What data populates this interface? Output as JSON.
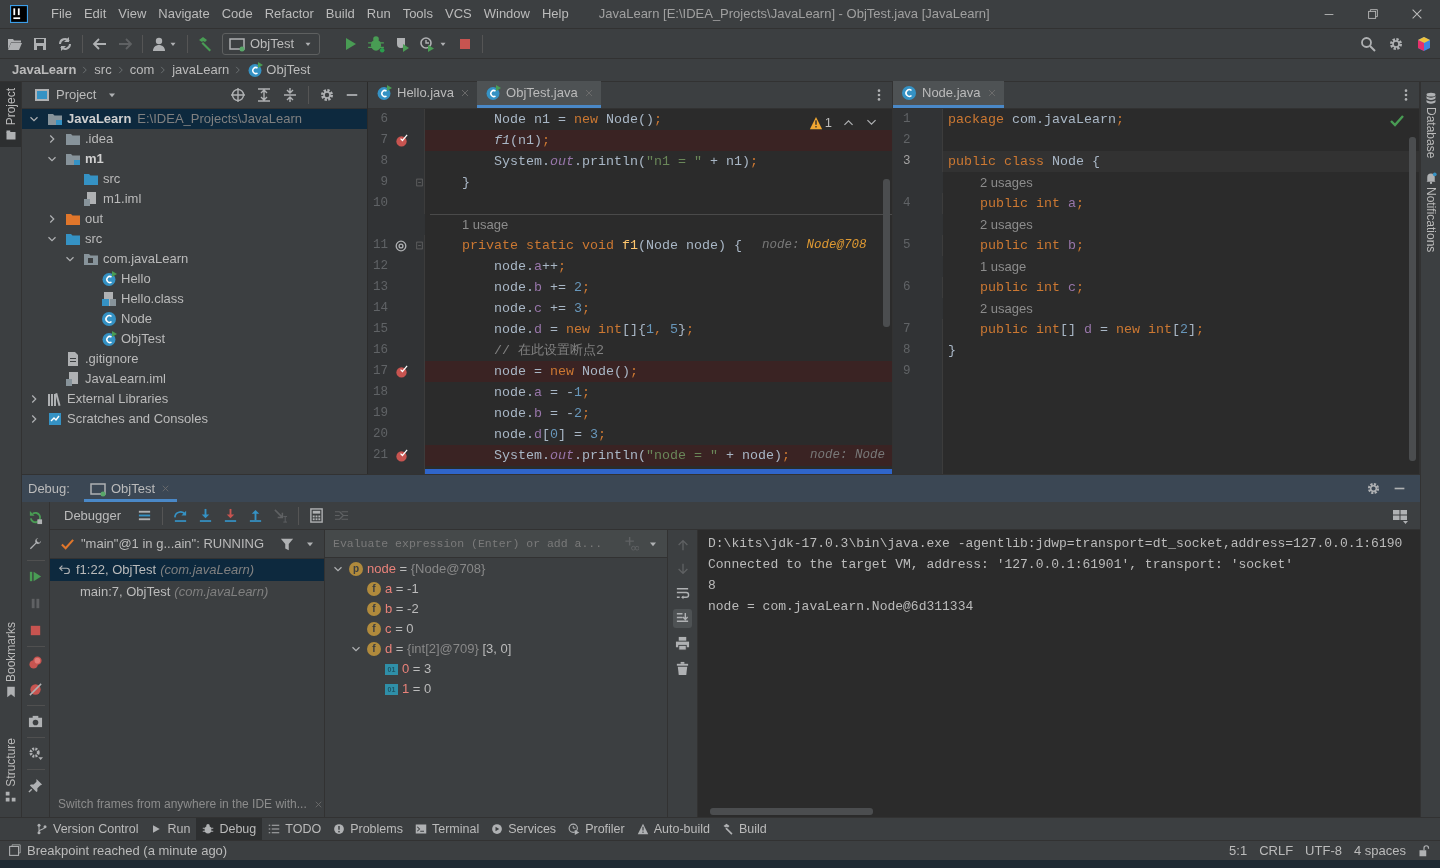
{
  "window": {
    "title": "JavaLearn [E:\\IDEA_Projects\\JavaLearn] - ObjTest.java [JavaLearn]"
  },
  "menu": [
    "File",
    "Edit",
    "View",
    "Navigate",
    "Code",
    "Refactor",
    "Build",
    "Run",
    "Tools",
    "VCS",
    "Window",
    "Help"
  ],
  "toolbar": {
    "run_config": "ObjTest"
  },
  "breadcrumb": [
    {
      "label": "JavaLearn",
      "kind": "project"
    },
    {
      "label": "src",
      "kind": "dir"
    },
    {
      "label": "com",
      "kind": "dir"
    },
    {
      "label": "javaLearn",
      "kind": "dir"
    },
    {
      "label": "ObjTest",
      "kind": "class"
    }
  ],
  "left_strip": [
    {
      "label": "Project",
      "selected": true
    },
    {
      "label": "Bookmarks",
      "selected": false
    },
    {
      "label": "Structure",
      "selected": false
    }
  ],
  "right_strip": [
    {
      "label": "Database",
      "kind": "database"
    },
    {
      "label": "Notifications",
      "kind": "bell"
    }
  ],
  "project": {
    "title": "Project",
    "tree": [
      {
        "label": "JavaLearn",
        "hint": "E:\\IDEA_Projects\\JavaLearn",
        "kind": "module",
        "bold": true,
        "expanded": true,
        "selected": true,
        "children": [
          {
            "label": ".idea",
            "kind": "folder",
            "expanded": false,
            "selected": false
          },
          {
            "label": "m1",
            "kind": "module",
            "bold": true,
            "expanded": true,
            "selected": false,
            "children": [
              {
                "label": "src",
                "kind": "src-folder",
                "selected": false
              },
              {
                "label": "m1.iml",
                "kind": "iml",
                "selected": false
              }
            ]
          },
          {
            "label": "out",
            "kind": "excluded-folder",
            "expanded": false,
            "selected": false
          },
          {
            "label": "src",
            "kind": "src-folder",
            "expanded": true,
            "selected": false,
            "children": [
              {
                "label": "com.javaLearn",
                "kind": "package",
                "expanded": true,
                "selected": false,
                "children": [
                  {
                    "label": "Hello",
                    "kind": "class-run",
                    "selected": false
                  },
                  {
                    "label": "Hello.class",
                    "kind": "class-file",
                    "selected": false
                  },
                  {
                    "label": "Node",
                    "kind": "class",
                    "selected": false
                  },
                  {
                    "label": "ObjTest",
                    "kind": "class-run",
                    "selected": false
                  }
                ]
              }
            ]
          },
          {
            "label": ".gitignore",
            "kind": "text-file",
            "selected": false
          },
          {
            "label": "JavaLearn.iml",
            "kind": "iml",
            "selected": false
          }
        ]
      },
      {
        "label": "External Libraries",
        "kind": "libraries",
        "expanded": false,
        "selected": false
      },
      {
        "label": "Scratches and Consoles",
        "kind": "scratches",
        "expanded": false,
        "selected": false
      }
    ]
  },
  "editors": [
    {
      "tabs": [
        {
          "label": "Hello.java",
          "kind": "class-run",
          "selected": false
        },
        {
          "label": "ObjTest.java",
          "kind": "class-run",
          "selected": true
        }
      ],
      "inspection": {
        "kind": "warning",
        "count": "1"
      },
      "lines": [
        {
          "kind": "method-code",
          "n": "6",
          "text": "Node n1 = new Node();"
        },
        {
          "kind": "method-code",
          "n": "7",
          "breakpoint": true,
          "text": "*f1*(n1);"
        },
        {
          "kind": "method-code",
          "n": "8",
          "text": "System.*out*.println(\"n1 = \" + n1);"
        },
        {
          "kind": "class-code",
          "n": "9",
          "fold": true,
          "text": "}"
        },
        {
          "kind": "code",
          "n": "10"
        },
        {
          "kind": "usage",
          "text": "1 usage"
        },
        {
          "kind": "class-code",
          "n": "11",
          "overrides": true,
          "fold": true,
          "text": "private static void f1(Node node) {",
          "hint": "node:",
          "hint_value": "Node@708"
        },
        {
          "kind": "method-code",
          "n": "12",
          "text": "node.a++;"
        },
        {
          "kind": "method-code",
          "n": "13",
          "text": "node.b += 2;"
        },
        {
          "kind": "method-code",
          "n": "14",
          "text": "node.c += 3;"
        },
        {
          "kind": "method-code",
          "n": "15",
          "text": "node.d = new int[]{1, 5};"
        },
        {
          "kind": "method-code",
          "n": "16",
          "text": "// 在此设置断点2"
        },
        {
          "kind": "method-code",
          "n": "17",
          "breakpoint": true,
          "text": "node = new Node();"
        },
        {
          "kind": "method-code",
          "n": "18",
          "text": "node.a = -1;"
        },
        {
          "kind": "method-code",
          "n": "19",
          "text": "node.b = -2;"
        },
        {
          "kind": "method-code",
          "n": "20",
          "text": "node.d[0] = 3;"
        },
        {
          "kind": "method-code",
          "n": "21",
          "breakpoint": true,
          "text": "System.*out*.println(\"node = \" + node);",
          "hint": "node: Node"
        }
      ]
    },
    {
      "tabs": [
        {
          "label": "Node.java",
          "kind": "class",
          "selected": true
        }
      ],
      "inspection": {
        "kind": "ok"
      },
      "lines": [
        {
          "kind": "code",
          "n": "1",
          "text": "package com.javaLearn;"
        },
        {
          "kind": "code",
          "n": "2"
        },
        {
          "kind": "code",
          "n": "3",
          "current": true,
          "text": "public class Node {"
        },
        {
          "kind": "usage",
          "text": "2 usages"
        },
        {
          "kind": "class-code",
          "n": "4",
          "text": "public int a;"
        },
        {
          "kind": "usage",
          "text": "2 usages"
        },
        {
          "kind": "class-code",
          "n": "5",
          "text": "public int b;"
        },
        {
          "kind": "usage",
          "text": "1 usage"
        },
        {
          "kind": "class-code",
          "n": "6",
          "text": "public int c;"
        },
        {
          "kind": "usage",
          "text": "2 usages"
        },
        {
          "kind": "class-code",
          "n": "7",
          "text": "public int[] d = new int[2];"
        },
        {
          "kind": "code",
          "n": "8",
          "text": "}"
        },
        {
          "kind": "code",
          "n": "9"
        }
      ]
    }
  ],
  "debug": {
    "label": "Debug:",
    "tabs": [
      {
        "label": "ObjTest",
        "selected": true
      }
    ],
    "subtabs": [
      {
        "label": "Debugger",
        "selected": true
      }
    ],
    "thread": "\"main\"@1 in g...ain\": RUNNING",
    "frames": [
      {
        "method": "f1:22, ObjTest",
        "package": "(com.javaLearn)",
        "selected": true
      },
      {
        "method": "main:7, ObjTest",
        "package": "(com.javaLearn)",
        "selected": false
      }
    ],
    "frames_hint": "Switch frames from anywhere in the IDE with...",
    "evaluate_placeholder": "Evaluate expression (Enter) or add a...",
    "variables": [
      {
        "badge": {
          "kind": "property",
          "text": "p"
        },
        "name": "node",
        "value": "=",
        "ref": "{Node@708}",
        "expanded": true,
        "children": [
          {
            "badge": {
              "kind": "field",
              "text": "f"
            },
            "name": "a",
            "value": "= -1"
          },
          {
            "badge": {
              "kind": "field",
              "text": "f"
            },
            "name": "b",
            "value": "= -2"
          },
          {
            "badge": {
              "kind": "field",
              "text": "f"
            },
            "name": "c",
            "value": "= 0"
          },
          {
            "badge": {
              "kind": "field",
              "text": "f"
            },
            "name": "d",
            "value": "=",
            "ref": "{int[2]@709}",
            "tail": "[3, 0]",
            "expanded": true,
            "children": [
              {
                "badge": {
                  "kind": "element",
                  "text": "01"
                },
                "name": "0",
                "value": "= 3"
              },
              {
                "badge": {
                  "kind": "element",
                  "text": "01"
                },
                "name": "1",
                "value": "= 0"
              }
            ]
          }
        ]
      }
    ],
    "console": [
      "D:\\kits\\jdk-17.0.3\\bin\\java.exe -agentlib:jdwp=transport=dt_socket,address=127.0.0.1:6190",
      "Connected to the target VM, address: '127.0.0.1:61901', transport: 'socket'",
      "8",
      "node = com.javaLearn.Node@6d311334"
    ]
  },
  "tool_windows": [
    {
      "label": "Version Control",
      "kind": "branch",
      "selected": false
    },
    {
      "label": "Run",
      "kind": "play",
      "selected": false
    },
    {
      "label": "Debug",
      "kind": "bug",
      "selected": true
    },
    {
      "label": "TODO",
      "kind": "list",
      "selected": false
    },
    {
      "label": "Problems",
      "kind": "info",
      "selected": false
    },
    {
      "label": "Terminal",
      "kind": "terminal",
      "selected": false
    },
    {
      "label": "Services",
      "kind": "services",
      "selected": false
    },
    {
      "label": "Profiler",
      "kind": "profiler",
      "selected": false
    },
    {
      "label": "Auto-build",
      "kind": "warning",
      "selected": false
    },
    {
      "label": "Build",
      "kind": "hammer",
      "selected": false
    }
  ],
  "status_bar": {
    "message": "Breakpoint reached (a minute ago)",
    "items": [
      "5:1",
      "CRLF",
      "UTF-8",
      "4 spaces"
    ]
  }
}
